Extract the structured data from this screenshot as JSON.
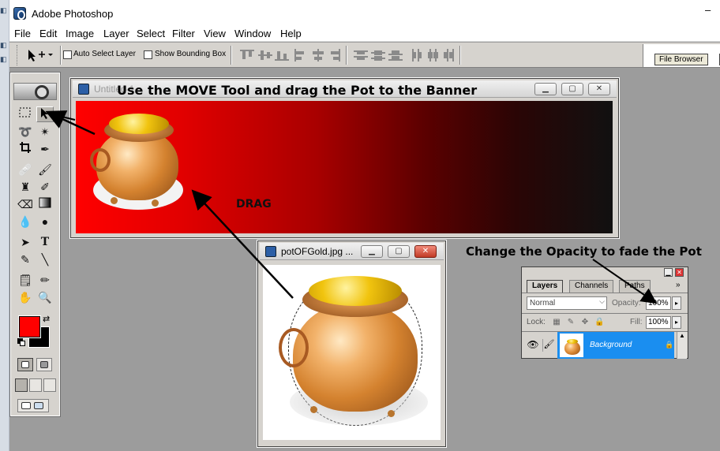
{
  "window": {
    "title": "Adobe Photoshop",
    "minimize_glyph": "–"
  },
  "menu": [
    "File",
    "Edit",
    "Image",
    "Layer",
    "Select",
    "Filter",
    "View",
    "Window",
    "Help"
  ],
  "options": {
    "auto_select_layer": "Auto Select Layer",
    "auto_select_checked": false,
    "show_bounding_box": "Show Bounding Box",
    "show_bounding_checked": false,
    "palette_well_tab": "File Browser"
  },
  "toolbox": {
    "foreground_color": "#ff0000",
    "background_color": "#000000",
    "tools": [
      "marquee-tool",
      "move-tool",
      "lasso-tool",
      "magic-wand-tool",
      "crop-tool",
      "slice-tool",
      "healing-brush-tool",
      "brush-tool",
      "clone-stamp-tool",
      "history-brush-tool",
      "eraser-tool",
      "gradient-tool",
      "blur-tool",
      "dodge-tool",
      "path-selection-tool",
      "type-tool",
      "pen-tool",
      "line-tool",
      "notes-tool",
      "eyedropper-tool",
      "hand-tool",
      "zoom-tool"
    ]
  },
  "banner_window": {
    "title": "Untitled-1"
  },
  "pot_window": {
    "title": "potOFGold.jpg ..."
  },
  "layers_panel": {
    "tabs": [
      "Layers",
      "Channels",
      "Paths"
    ],
    "active_tab": "Layers",
    "blend_mode": "Normal",
    "opacity_label": "Opacity:",
    "opacity_value": "100%",
    "lock_label": "Lock:",
    "fill_label": "Fill:",
    "fill_value": "100%",
    "layers": [
      {
        "name": "Background",
        "visible": true,
        "locked": true
      }
    ]
  },
  "annotations": {
    "move_instruction": "Use the MOVE Tool and drag the Pot to the Banner",
    "drag_label": "DRAG",
    "opacity_instruction": "Change the Opacity to fade the Pot"
  }
}
